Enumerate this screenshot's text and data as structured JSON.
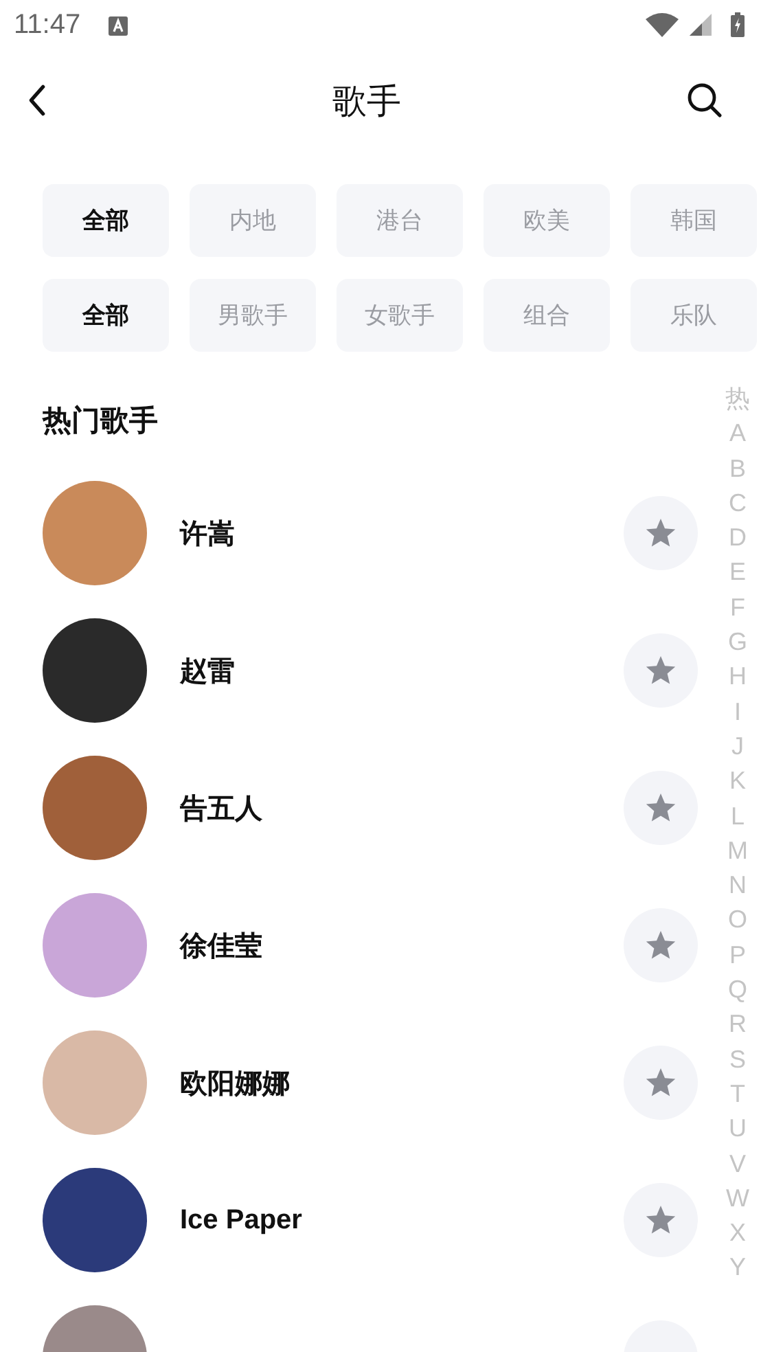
{
  "status_bar": {
    "time": "11:47"
  },
  "header": {
    "title": "歌手"
  },
  "filters": [
    [
      {
        "label": "全部",
        "selected": true
      },
      {
        "label": "内地",
        "selected": false
      },
      {
        "label": "港台",
        "selected": false
      },
      {
        "label": "欧美",
        "selected": false
      },
      {
        "label": "韩国",
        "selected": false
      }
    ],
    [
      {
        "label": "全部",
        "selected": true
      },
      {
        "label": "男歌手",
        "selected": false
      },
      {
        "label": "女歌手",
        "selected": false
      },
      {
        "label": "组合",
        "selected": false
      },
      {
        "label": "乐队",
        "selected": false
      }
    ]
  ],
  "section_title": "热门歌手",
  "singers": [
    {
      "kind": "full",
      "name": "许嵩"
    },
    {
      "kind": "full",
      "name": "赵雷"
    },
    {
      "kind": "full",
      "name": "告五人"
    },
    {
      "kind": "full",
      "name": "徐佳莹"
    },
    {
      "kind": "full",
      "name": "欧阳娜娜"
    },
    {
      "kind": "full",
      "name": "Ice Paper"
    },
    {
      "kind": "cut"
    }
  ],
  "index": [
    "热",
    "A",
    "B",
    "C",
    "D",
    "E",
    "F",
    "G",
    "H",
    "I",
    "J",
    "K",
    "L",
    "M",
    "N",
    "O",
    "P",
    "Q",
    "R",
    "S",
    "T",
    "U",
    "V",
    "W",
    "X",
    "Y"
  ]
}
